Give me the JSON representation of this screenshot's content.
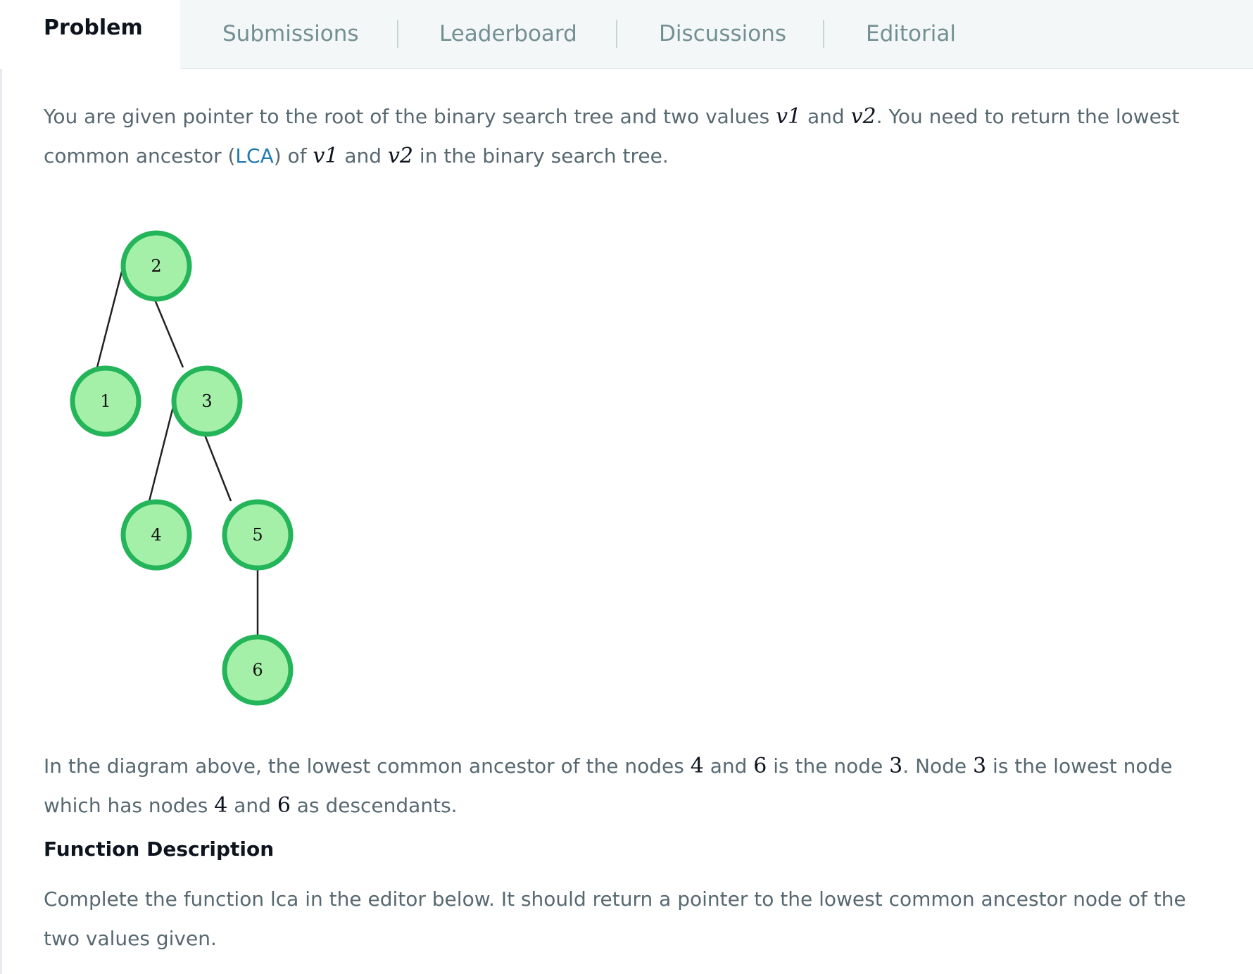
{
  "tabs": {
    "active": "Problem",
    "items": [
      "Submissions",
      "Leaderboard",
      "Discussions",
      "Editorial"
    ]
  },
  "intro": {
    "part1": "You are given pointer to the root of the binary search tree and two values ",
    "v1": "v1",
    "and1": " and ",
    "v2": "v2",
    "part2": ". You need to return the lowest common ancestor (",
    "lca_link": "LCA",
    "part3": ") of ",
    "and2": " and ",
    "part4": " in the binary search tree."
  },
  "tree": {
    "nodes": [
      "2",
      "1",
      "3",
      "4",
      "5",
      "6"
    ],
    "node_fill": "#a5f0a9",
    "node_stroke": "#24b45a"
  },
  "explanation": {
    "p1": "In the diagram above, the lowest common ancestor of the nodes ",
    "n4": "4",
    "a1": " and ",
    "n6": "6",
    "p2": " is the node ",
    "n3": "3",
    "p3": ". Node ",
    "p4": " is the lowest node which has nodes ",
    "a2": " and ",
    "p5": " as descendants."
  },
  "function_description": {
    "heading": "Function Description",
    "text": "Complete the function lca in the editor below. It should return a pointer to the lowest common ancestor node of the two values given."
  }
}
